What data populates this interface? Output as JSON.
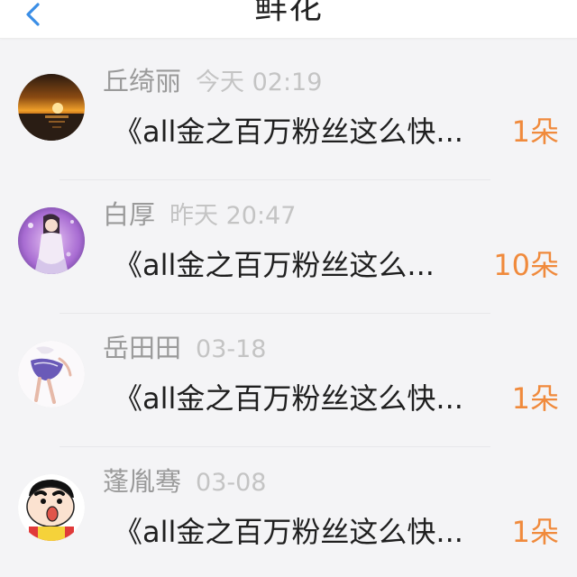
{
  "header": {
    "title": "鲜花",
    "back_icon": "chevron-left-icon",
    "back_color": "#3a8ee6"
  },
  "accent_color": "#f08a3c",
  "items": [
    {
      "name": "丘绮丽",
      "time": "今天 02:19",
      "message": "《all金之百万粉丝这么快...",
      "count": "1朵",
      "avatar": "sunset-avatar-icon"
    },
    {
      "name": "白厚",
      "time": "昨天 20:47",
      "message": "《all金之百万粉丝这么...",
      "count": "10朵",
      "avatar": "girl-portrait-avatar-icon"
    },
    {
      "name": "岳田田",
      "time": "03-18",
      "message": "《all金之百万粉丝这么快...",
      "count": "1朵",
      "avatar": "sketch-girl-avatar-icon"
    },
    {
      "name": "蓬胤骞",
      "time": "03-08",
      "message": "《all金之百万粉丝这么快...",
      "count": "1朵",
      "avatar": "cartoon-boy-avatar-icon"
    }
  ]
}
